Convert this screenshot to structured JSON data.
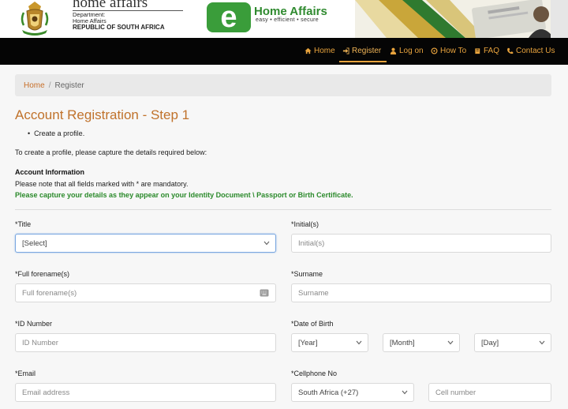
{
  "header": {
    "brand_word": "home affairs",
    "dept_line1": "Department:",
    "dept_line2": "Home Affairs",
    "dept_line3": "REPUBLIC OF SOUTH AFRICA",
    "logo_letter": "e",
    "logo_title": "Home Affairs",
    "logo_tagline": "easy • efficient • secure"
  },
  "nav": {
    "items": [
      {
        "label": "Home",
        "icon": "home-icon"
      },
      {
        "label": "Register",
        "icon": "sign-in-icon"
      },
      {
        "label": "Log on",
        "icon": "user-icon"
      },
      {
        "label": "How To",
        "icon": "circle-icon"
      },
      {
        "label": "FAQ",
        "icon": "book-icon"
      },
      {
        "label": "Contact Us",
        "icon": "phone-icon"
      }
    ],
    "active": "Register"
  },
  "breadcrumb": {
    "home": "Home",
    "separator": "/",
    "current": "Register"
  },
  "page": {
    "title": "Account Registration - Step 1",
    "bullet": "Create a profile.",
    "intro": "To create a profile, please capture the details required below:",
    "section_heading": "Account Information",
    "mandatory_note": "Please note that all fields marked with * are mandatory.",
    "capture_note": "Please capture your details as they appear on your Identity Document \\ Passport or Birth Certificate."
  },
  "form": {
    "title_label": "*Title",
    "title_value": "[Select]",
    "initials_label": "*Initial(s)",
    "initials_placeholder": "Initial(s)",
    "forename_label": "*Full forename(s)",
    "forename_placeholder": "Full forename(s)",
    "surname_label": "*Surname",
    "surname_placeholder": "Surname",
    "id_label": "*ID Number",
    "id_placeholder": "ID Number",
    "dob_label": "*Date of Birth",
    "dob_year": "[Year]",
    "dob_month": "[Month]",
    "dob_day": "[Day]",
    "email_label": "*Email",
    "email_placeholder": "Email address",
    "cell_label": "*Cellphone No",
    "cell_country": "South Africa (+27)",
    "cell_placeholder": "Cell number"
  },
  "colors": {
    "accent_orange": "#c0722b",
    "nav_text": "#e8a33d",
    "brand_green": "#3a9d3a",
    "note_green": "#2b8a2b"
  }
}
